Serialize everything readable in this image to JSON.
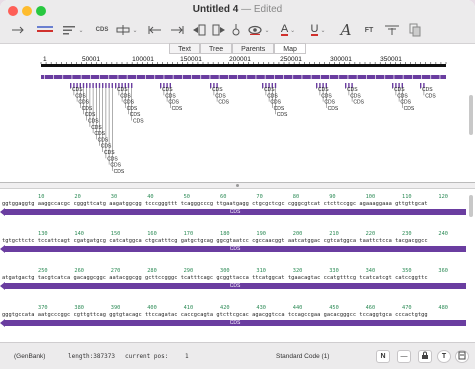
{
  "window": {
    "title": "Untitled 4",
    "title_suffix": "— Edited"
  },
  "toolbar": {
    "cds_label": "CDS",
    "font_label": "FT",
    "underline_label": "U",
    "text_color_label": "A",
    "italic_a": "A"
  },
  "tabs": [
    {
      "label": "Text",
      "active": false
    },
    {
      "label": "Tree",
      "active": false
    },
    {
      "label": "Parents",
      "active": false
    },
    {
      "label": "Map",
      "active": true
    }
  ],
  "map": {
    "ruler_labels": [
      "1",
      "50001",
      "100001",
      "150001",
      "200001",
      "250001",
      "300001",
      "350001"
    ],
    "feature_label": "CDS"
  },
  "sequence": {
    "rows": [
      {
        "numbers": [
          "10",
          "20",
          "30",
          "40",
          "50",
          "60",
          "70",
          "80",
          "90",
          "100",
          "110",
          "120"
        ],
        "text": "ggtggaggtg aaggccacgc cgggttcatg aagatggcgg tcccgggttt tcagggcccg ttgaatgagg ctgcgctcgc cgggcgtcat ctcttccggc agaaaggaaa gttgttgcat",
        "feature": "CDS"
      },
      {
        "numbers": [
          "130",
          "140",
          "150",
          "160",
          "170",
          "180",
          "190",
          "200",
          "210",
          "220",
          "230",
          "240"
        ],
        "text": "tgtgcttctc tccattcagt cgatgatgcg catcatggca ctgcatttcg gatgctgcag ggcgtaatcc cgccaacggt aatcatggac cgtcatggca taattctcca tacgacggcc",
        "feature": "CDS"
      },
      {
        "numbers": [
          "250",
          "260",
          "270",
          "280",
          "290",
          "300",
          "310",
          "320",
          "330",
          "340",
          "350",
          "360"
        ],
        "text": "atgatgactg tacgtcatca gacaggcggc aatacggcgg gcttccgggc tcatttcagc gcggttacca ttcatggcat tgaacagtac ccatgtttcg tcatcatcgt catccggttc",
        "feature": "CDS"
      },
      {
        "numbers": [
          "370",
          "380",
          "390",
          "400",
          "410",
          "420",
          "430",
          "440",
          "450",
          "460",
          "470",
          "480"
        ],
        "text": "gggtgccata aatgcccggc cgttgttcag ggtgtacagc ttccagatac caccgcagta gtcttcgcac agacggtcca tccagccgaa gacacgggcc tccaggtgca cccactgtgg",
        "feature": "CDS"
      }
    ]
  },
  "status": {
    "format": "(GenBank)",
    "length_label": "length:387373",
    "pos_label": "current pos:",
    "pos_value": "1",
    "code": "Standard Code (1)",
    "btn_n": "N",
    "btn_dash": "—",
    "btn_t": "T"
  },
  "colors": {
    "cds": "#6a3da0",
    "accent_red": "#d0312d",
    "seq_number": "#2b8a55"
  }
}
